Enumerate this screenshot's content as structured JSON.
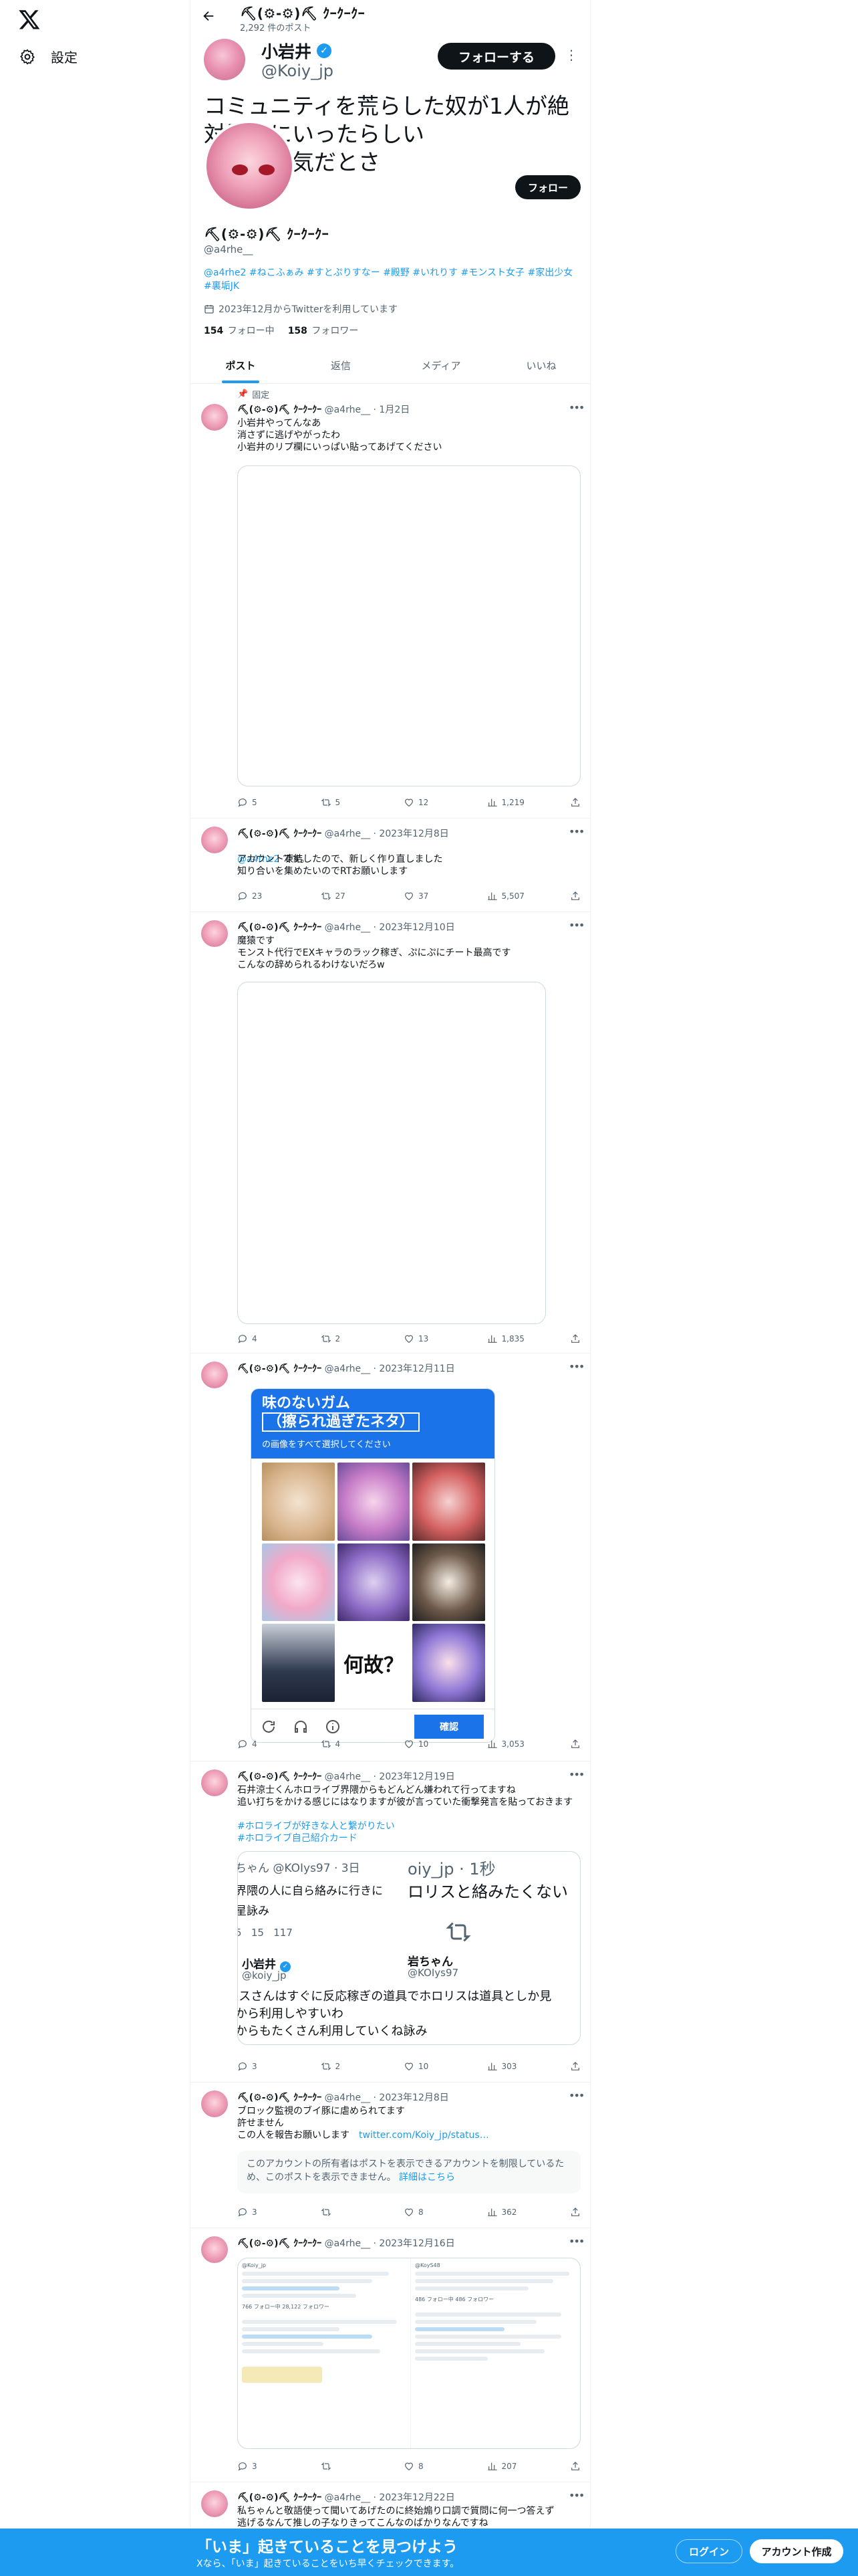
{
  "nav": {
    "settings_label": "設定"
  },
  "header": {
    "name": "⛏(⚙-⚙)⛏ ｸｰｸｰｸｰ",
    "post_count": "2,292 件のポスト"
  },
  "overlay": {
    "name": "小岩井",
    "handle": "@Koiy_jp",
    "follow_label": "フォローする",
    "text": "コミュニティを荒らした奴が1人が絶対零度にいったらしい\n皆様お元気だとさ"
  },
  "profile": {
    "follow_label": "フォロー",
    "name": "⛏(⚙-⚙)⛏ ｸｰｸｰｸｰ",
    "handle": "@a4rhe__",
    "bio": "@a4rhe2 #ねこふぁみ #すとぷりすなー #殿野 #いれりす #モンスト女子 #家出少女 #裏垢JK",
    "joined": "2023年12月からTwitterを利用しています",
    "following_count": "154",
    "following_label": "フォロー中",
    "followers_count": "158",
    "followers_label": "フォロワー"
  },
  "tabs": [
    "ポスト",
    "返信",
    "メディア",
    "いいね"
  ],
  "tweets": [
    {
      "pinned": "固定",
      "name": "⛏(⚙-⚙)⛏ ｸｰｸｰｸｰ",
      "handle": "@a4rhe__",
      "date": "· 1月2日",
      "text": "小岩井やってんなあ\n消さずに逃げやがったわ\n小岩井のリプ欄にいっぱい貼ってあげてください",
      "replies": "5",
      "reposts": "5",
      "likes": "12",
      "views": "1,219"
    },
    {
      "name": "⛏(⚙-⚙)⛏ ｸｰｸｰｸｰ",
      "handle": "@a4rhe__",
      "date": "· 2023年12月8日",
      "mention": "@a4rhe2",
      "text_after_mention": " です。",
      "text": "アカウント凍結したので、新しく作り直しました\n知り合いを集めたいのでRTお願いします",
      "replies": "23",
      "reposts": "27",
      "likes": "37",
      "views": "5,507"
    },
    {
      "name": "⛏(⚙-⚙)⛏ ｸｰｸｰｸｰ",
      "handle": "@a4rhe__",
      "date": "· 2023年12月10日",
      "text": "魔猿です\nモンスト代行でEXキャラのラック稼ぎ、ぷにぷにチート最高です\nこんなの辞められるわけないだろw",
      "replies": "4",
      "reposts": "2",
      "likes": "13",
      "views": "1,835"
    },
    {
      "name": "⛏(⚙-⚙)⛏ ｸｰｸｰｸｰ",
      "handle": "@a4rhe__",
      "date": "· 2023年12月11日",
      "captcha_title_1": "味のないガム",
      "captcha_title_2": "（擦られ過ぎたネタ）",
      "captcha_sub": "の画像をすべて選択してください",
      "captcha_q": "何故？",
      "captcha_verify": "確認",
      "replies": "4",
      "reposts": "4",
      "likes": "10",
      "views": "3,053"
    },
    {
      "name": "⛏(⚙-⚙)⛏ ｸｰｸｰｸｰ",
      "handle": "@a4rhe__",
      "date": "· 2023年12月19日",
      "text": "石井涼士くんホロライブ界隈からもどんどん嫌われて行ってますね\n追い打ちをかける感じにはなりますが彼が言っていた衝撃発言を貼っておきます",
      "tags": "#ホロライブが好きな人と繋がりたい\n#ホロライブ自己紹介カード",
      "quote_left_top": "ちゃん @KOIys97 · 3日",
      "quote_left_line1": "界隈の人に自ら絡みに行きに",
      "quote_left_line2": "星詠み",
      "quote_left_stats": "5   15   117",
      "quote_right_top": "oiy_jp · 1秒",
      "quote_right_line1": "ロリスと絡みたくない",
      "quote_name_1": "小岩井",
      "quote_handle_1": "@koiy_jp",
      "quote_name_2": "岩ちゃん",
      "quote_handle_2": "@KOIys97",
      "quote_bottom": "Iスさんはすぐに反応稼ぎの道具でホロリスは道具としか見\nから利用しやすいわ\nからもたくさん利用していくね詠み",
      "replies": "3",
      "reposts": "2",
      "likes": "10",
      "views": "303"
    },
    {
      "name": "⛏(⚙-⚙)⛏ ｸｰｸｰｸｰ",
      "handle": "@a4rhe__",
      "date": "· 2023年12月8日",
      "text": "ブロック監視のブイ豚に虐められてます\n許せません\nこの人を報告お願いします",
      "link": "twitter.com/Koiy_jp/status…",
      "notice": "このアカウントの所有者はポストを表示できるアカウントを制限しているため、このポストを表示できません。",
      "notice_link": "詳細はこちら",
      "replies": "3",
      "reposts": "",
      "likes": "8",
      "views": "362"
    },
    {
      "name": "⛏(⚙-⚙)⛏ ｸｰｸｰｸｰ",
      "handle": "@a4rhe__",
      "date": "· 2023年12月16日",
      "ss_left_handle": "@Koiy_jp",
      "ss_right_handle": "@KoyS48",
      "ss_left_stats": "766 フォロー中  28,122 フォロワー",
      "ss_right_stats": "486 フォロー中  486 フォロワー",
      "replies": "3",
      "reposts": "",
      "likes": "8",
      "views": "207"
    },
    {
      "name": "⛏(⚙-⚙)⛏ ｸｰｸｰｸｰ",
      "handle": "@a4rhe__",
      "date": "· 2023年12月22日",
      "text": "私ちゃんと敬語使って聞いてあげたのに終始煽り口調で質問に何一つ答えず\n逃げるなんて推しの子なりきってこんなのばかりなんですね"
    }
  ],
  "banner": {
    "title": "「いま」起きていることを見つけよう",
    "subtitle": "Xなら、「いま」起きていることをいち早くチェックできます。",
    "login": "ログイン",
    "signup": "アカウント作成"
  },
  "colors": {
    "accent": "#1d9bf0",
    "text": "#0f1419",
    "muted": "#536471"
  }
}
